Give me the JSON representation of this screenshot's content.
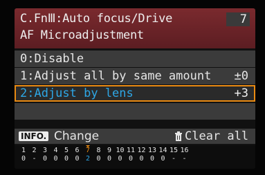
{
  "header": {
    "line1": "C.FnⅢ:Auto focus/Drive",
    "line2": "AF Microadjustment",
    "tab_number": "7"
  },
  "options": [
    {
      "label": "0:Disable",
      "value": ""
    },
    {
      "label": "1:Adjust all by same amount",
      "value": "±0"
    },
    {
      "label": "2:Adjust by lens",
      "value": "+3"
    }
  ],
  "selected_index": 2,
  "footer": {
    "info_button": "INFO.",
    "change_label": "Change",
    "trash_icon": "trash-icon",
    "clear_label": "Clear all"
  },
  "strip": {
    "numbers": [
      "1",
      "2",
      "3",
      "4",
      "5",
      "6",
      "7",
      "8",
      "9",
      "10",
      "11",
      "12",
      "13",
      "14",
      "15",
      "16"
    ],
    "values": [
      "0",
      "-",
      "0",
      "0",
      "0",
      "0",
      "2",
      "0",
      "0",
      "0",
      "0",
      "0",
      "0",
      "0",
      "-",
      "-"
    ],
    "active_index": 6
  },
  "colors": {
    "header_bg": "#6e2328",
    "accent_orange": "#e98a12",
    "accent_blue": "#2ea7e6",
    "row_bg": "#3b3b3b"
  }
}
